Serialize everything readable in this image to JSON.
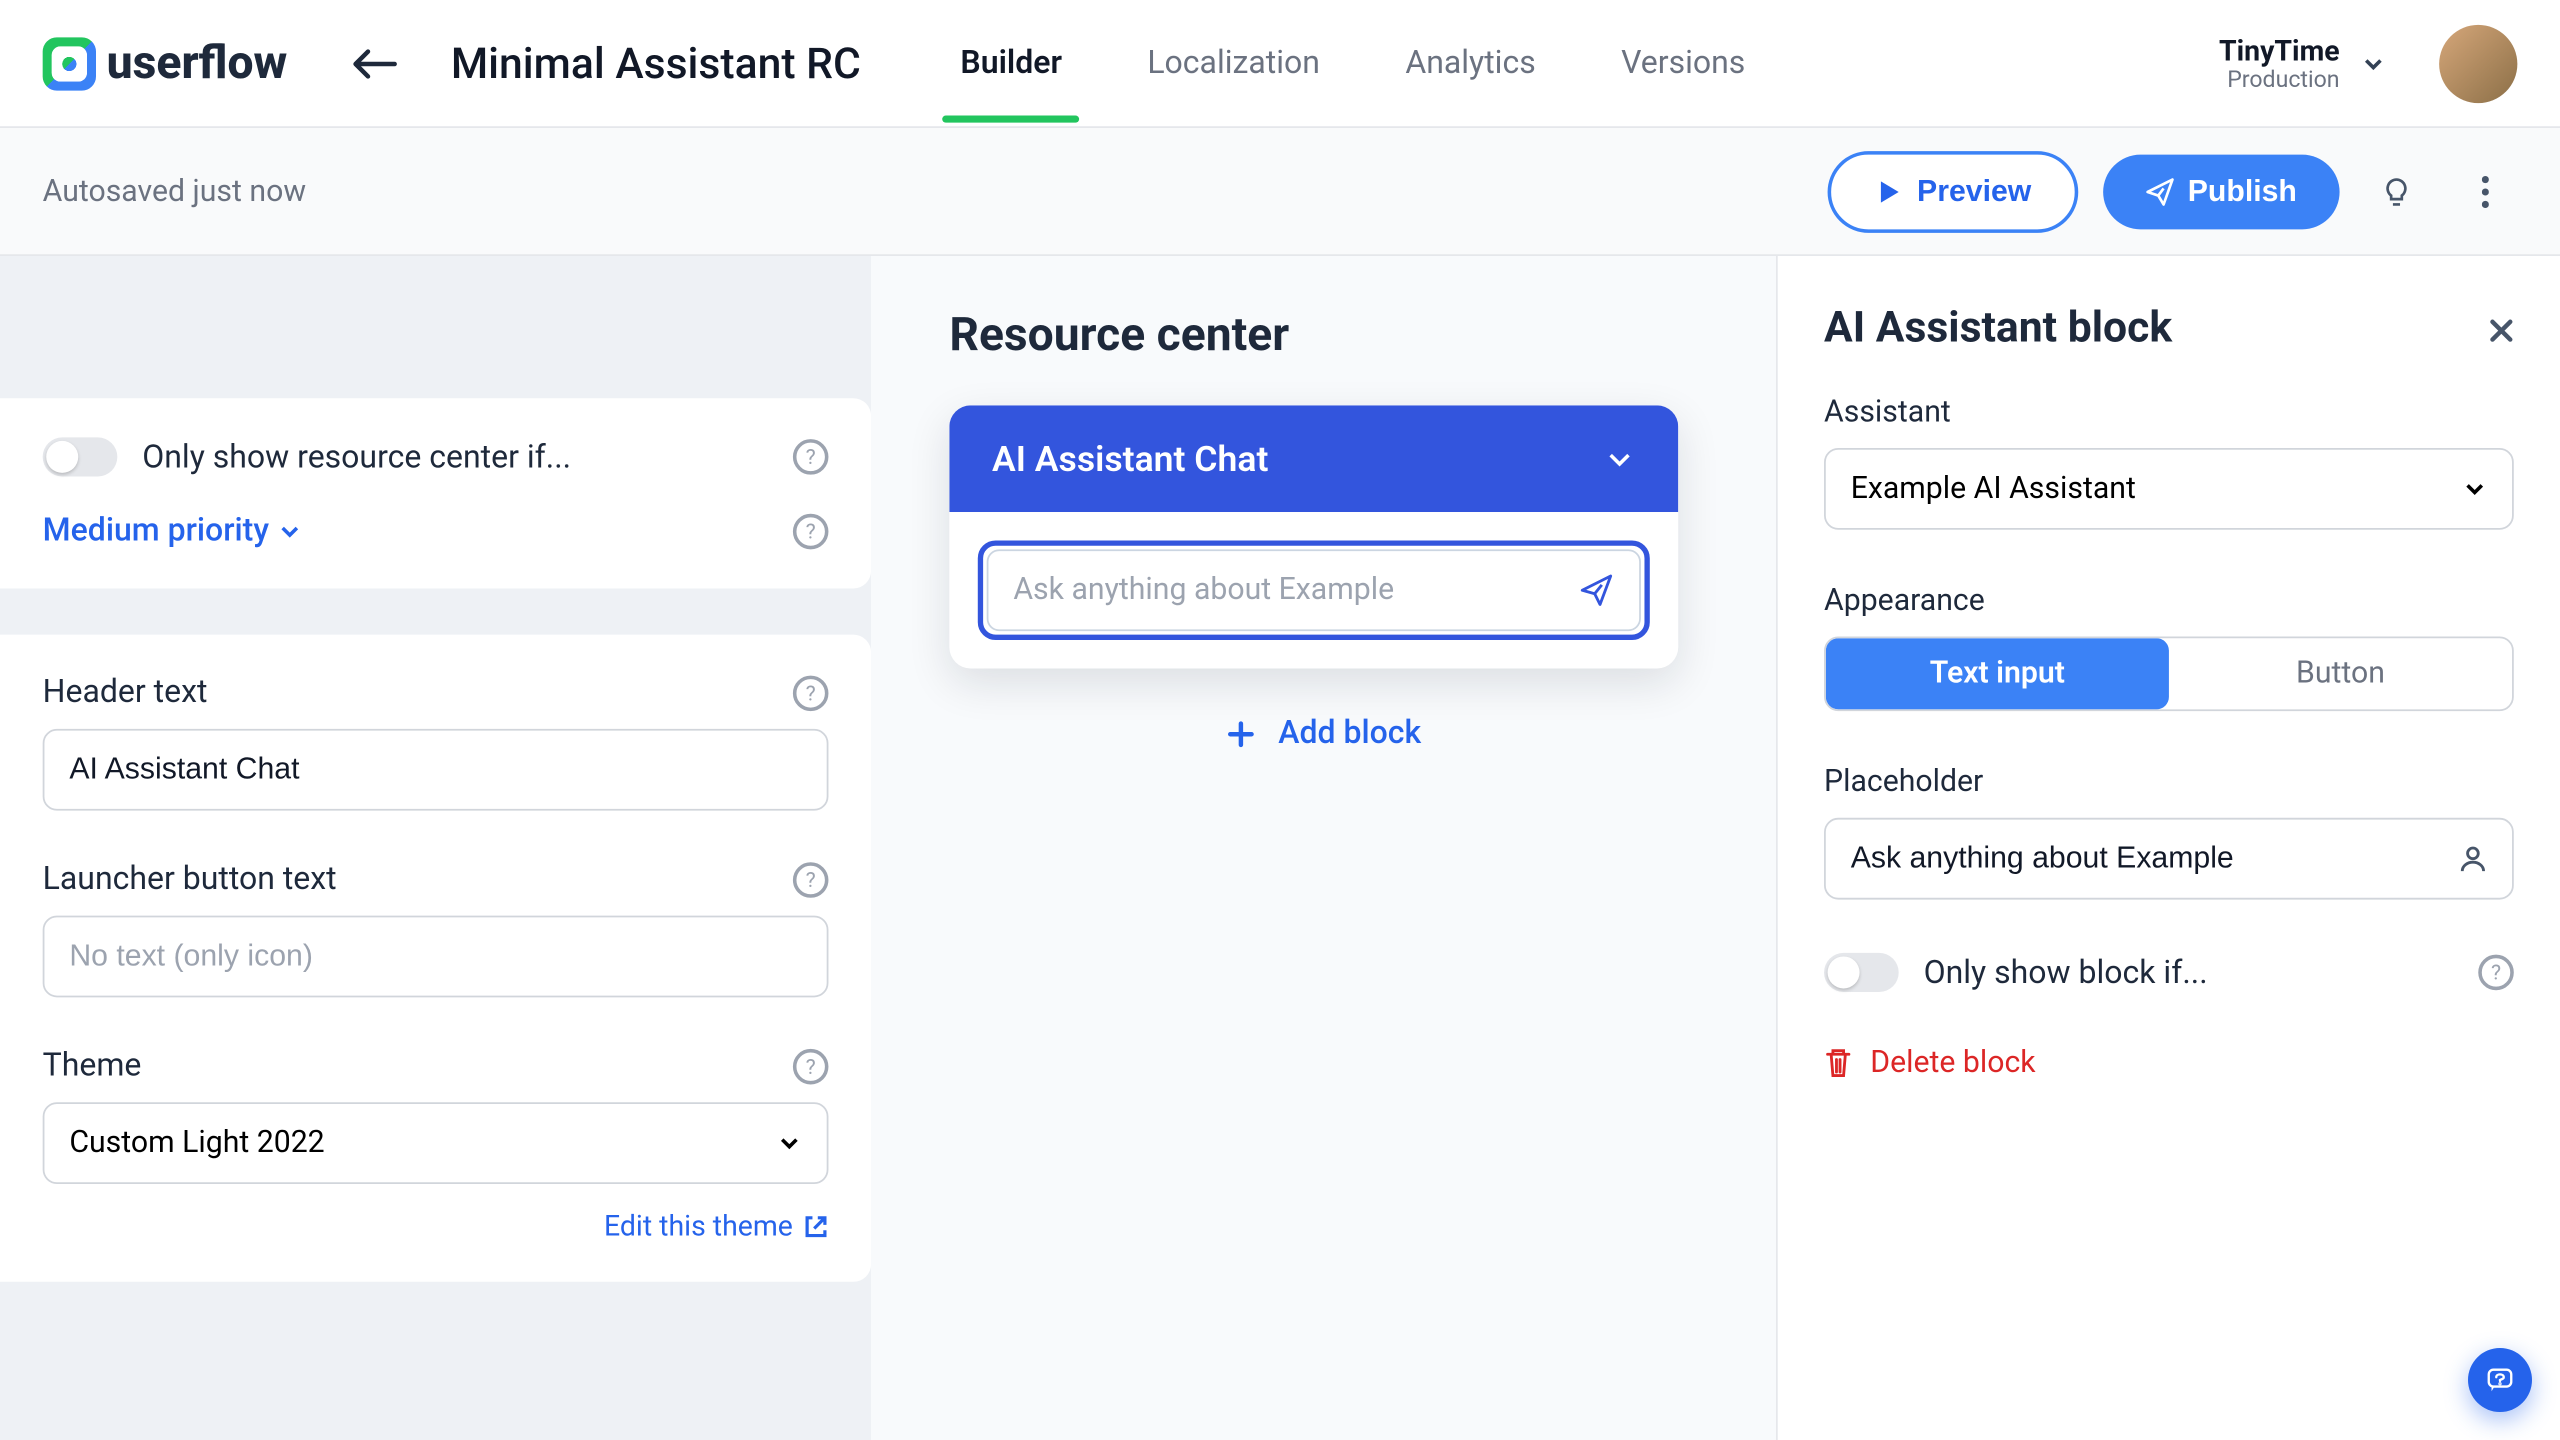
{
  "brand": "userflow",
  "page_title": "Minimal Assistant RC",
  "tabs": [
    "Builder",
    "Localization",
    "Analytics",
    "Versions"
  ],
  "workspace": {
    "name": "TinyTime",
    "env": "Production"
  },
  "actionbar": {
    "autosave": "Autosaved just now",
    "preview": "Preview",
    "publish": "Publish"
  },
  "left": {
    "show_if_label": "Only show resource center if...",
    "priority": "Medium priority",
    "header_text": {
      "label": "Header text",
      "value": "AI Assistant Chat"
    },
    "launcher_text": {
      "label": "Launcher button text",
      "placeholder": "No text (only icon)"
    },
    "theme": {
      "label": "Theme",
      "value": "Custom Light 2022",
      "edit_link": "Edit this theme"
    }
  },
  "center": {
    "title": "Resource center",
    "block_header": "AI Assistant Chat",
    "chat_placeholder": "Ask anything about Example",
    "add_block": "Add block"
  },
  "right": {
    "panel_title": "AI Assistant block",
    "assistant": {
      "label": "Assistant",
      "value": "Example AI Assistant"
    },
    "appearance": {
      "label": "Appearance",
      "options": [
        "Text input",
        "Button"
      ]
    },
    "placeholder": {
      "label": "Placeholder",
      "value": "Ask anything about Example"
    },
    "show_if_label": "Only show block if...",
    "delete": "Delete block"
  }
}
